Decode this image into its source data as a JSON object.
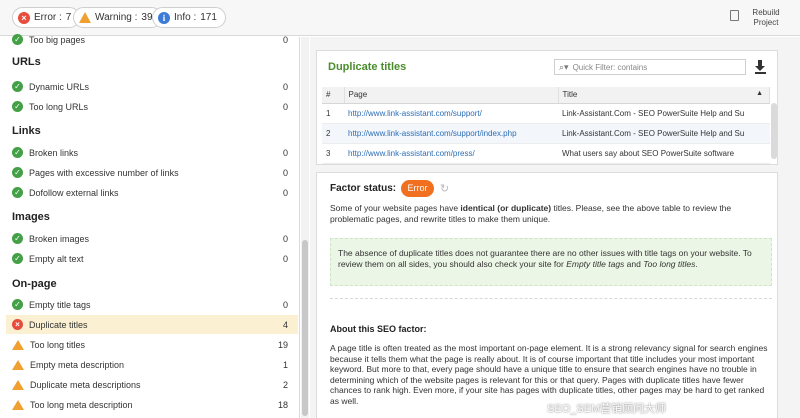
{
  "toolbar": {
    "error_label": "Error :",
    "error_count": "7",
    "warning_label": "Warning :",
    "warning_count": "39",
    "info_label": "Info :",
    "info_count": "171",
    "rebuild_line1": "Rebuild",
    "rebuild_line2": "Project"
  },
  "sidebar": {
    "top_item": {
      "label": "Too big pages",
      "count": "0",
      "status": "ok"
    },
    "sections": [
      {
        "title": "URLs",
        "items": [
          {
            "label": "Dynamic URLs",
            "count": "0",
            "status": "ok"
          },
          {
            "label": "Too long URLs",
            "count": "0",
            "status": "ok"
          }
        ]
      },
      {
        "title": "Links",
        "items": [
          {
            "label": "Broken links",
            "count": "0",
            "status": "ok"
          },
          {
            "label": "Pages with excessive number of links",
            "count": "0",
            "status": "ok"
          },
          {
            "label": "Dofollow external links",
            "count": "0",
            "status": "ok"
          }
        ]
      },
      {
        "title": "Images",
        "items": [
          {
            "label": "Broken images",
            "count": "0",
            "status": "ok"
          },
          {
            "label": "Empty alt text",
            "count": "0",
            "status": "ok"
          }
        ]
      },
      {
        "title": "On-page",
        "items": [
          {
            "label": "Empty title tags",
            "count": "0",
            "status": "ok"
          },
          {
            "label": "Duplicate titles",
            "count": "4",
            "status": "error"
          },
          {
            "label": "Too long titles",
            "count": "19",
            "status": "warning"
          },
          {
            "label": "Empty meta description",
            "count": "1",
            "status": "warning"
          },
          {
            "label": "Duplicate meta descriptions",
            "count": "2",
            "status": "warning"
          },
          {
            "label": "Too long meta description",
            "count": "18",
            "status": "warning"
          }
        ]
      }
    ]
  },
  "details": {
    "title": "Duplicate titles",
    "filter_placeholder": "Quick Filter: contains",
    "columns": [
      "#",
      "Page",
      "Title"
    ],
    "rows": [
      {
        "num": "1",
        "page": "http://www.link-assistant.com/support/",
        "title": "Link-Assistant.Com - SEO PowerSuite Help and Su"
      },
      {
        "num": "2",
        "page": "http://www.link-assistant.com/support/index.php",
        "title": "Link-Assistant.Com - SEO PowerSuite Help and Su"
      },
      {
        "num": "3",
        "page": "http://www.link-assistant.com/press/",
        "title": "What users say about SEO PowerSuite software"
      }
    ]
  },
  "factor": {
    "label": "Factor status:",
    "status": "Error",
    "desc_pre": "Some of your website pages have ",
    "desc_bold": "identical (or duplicate)",
    "desc_post": " titles. Please, see the above table to review the problematic pages, and rewrite titles to make them unique.",
    "note_pre": "The absence of duplicate titles does not guarantee there are no other issues with title tags on your website. To review them on all sides, you should also check your site for ",
    "note_em1": "Empty title tags",
    "note_mid": " and ",
    "note_em2": "Too long titles",
    "note_post": ".",
    "about_title": "About this SEO factor:",
    "about_text": "A page title is often treated as the most important on-page element. It is a strong relevancy signal for search engines because it tells them what the page is really about. It is of course important that title includes your most important keyword. But more to that, every page should have a unique title to ensure that search engines have no trouble in determining which of the website pages is relevant for this or that query. Pages with duplicate titles have fewer chances to rank high. Even more, if your site has pages with duplicate titles, other pages may be hard to get ranked as well."
  },
  "watermark": "SEO_SEM营销顾问大师",
  "colors": {
    "error": "#e74c3c",
    "warning": "#f0a030",
    "ok": "#43a047",
    "accent_green": "#4a8d2c",
    "badge": "#f07020"
  }
}
